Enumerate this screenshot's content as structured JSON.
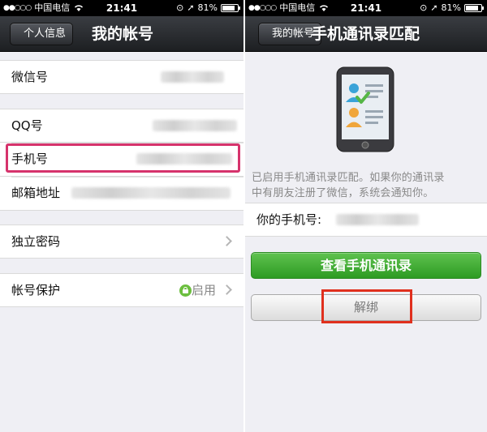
{
  "status_bar": {
    "carrier": "中国电信",
    "time": "21:41",
    "battery": "81%",
    "battery_level": 0.81
  },
  "left_screen": {
    "back_label": "个人信息",
    "title": "我的帐号",
    "rows": {
      "wechat_id": "微信号",
      "qq": "QQ号",
      "mobile": "手机号",
      "email": "邮箱地址",
      "password": "独立密码",
      "protection": "帐号保护"
    },
    "protection_status": "启用"
  },
  "right_screen": {
    "back_label": "我的帐号",
    "title": "手机通讯录匹配",
    "info_text_line1": "已启用手机通讯录匹配。如果你的通讯录",
    "info_text_line2": "中有朋友注册了微信，系统会通知你。",
    "phone_label": "你的手机号:",
    "view_contacts_button": "查看手机通讯录",
    "unbind_button": "解绑"
  },
  "colors": {
    "highlight_pink": "#d6336c",
    "highlight_red": "#e0301e",
    "button_green": "#2d9b23"
  }
}
